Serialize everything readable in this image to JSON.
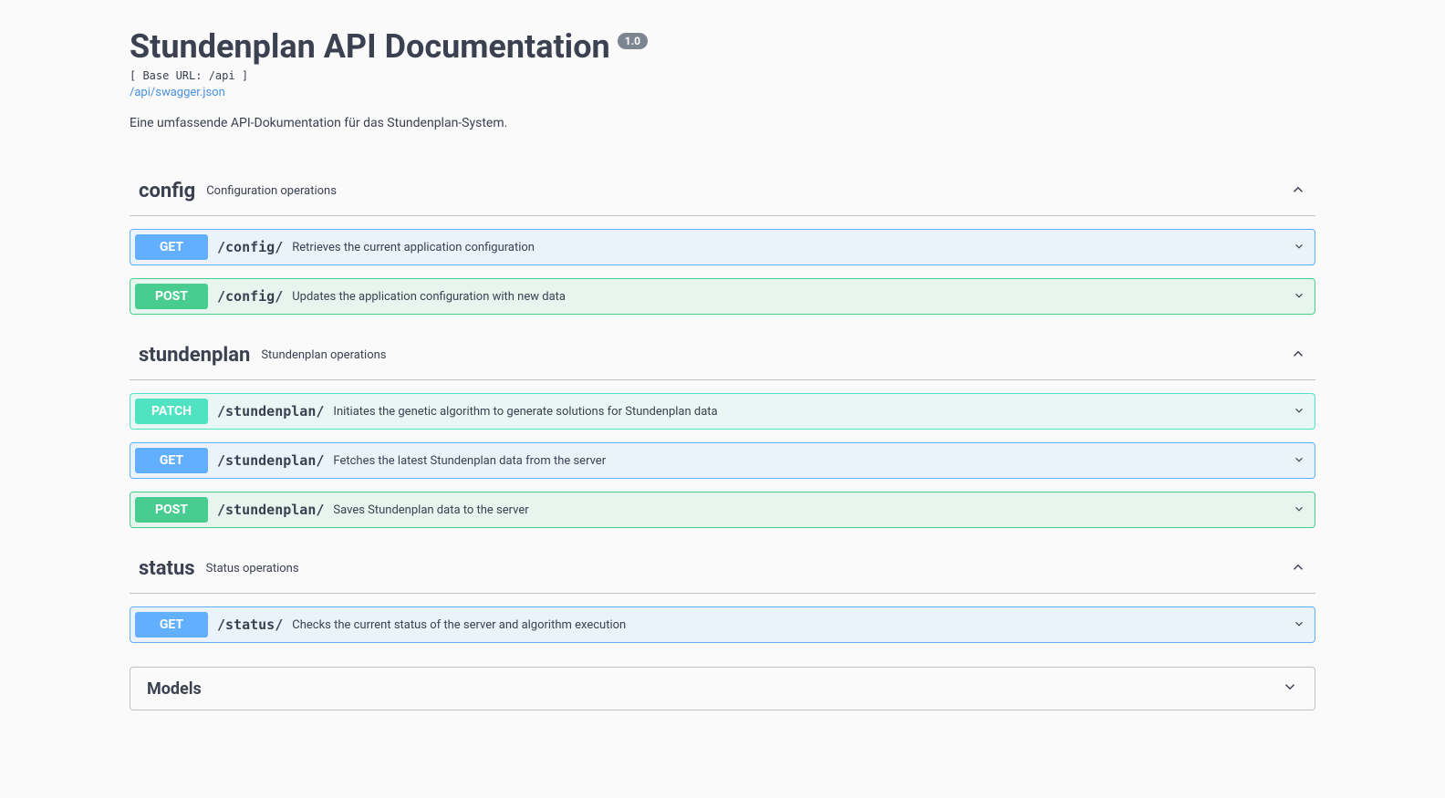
{
  "header": {
    "title": "Stundenplan API Documentation",
    "version": "1.0",
    "base_url_label": "[ Base URL: /api ]",
    "swagger_link": "/api/swagger.json",
    "description": "Eine umfassende API-Dokumentation für das Stundenplan-System."
  },
  "tags": [
    {
      "name": "config",
      "description": "Configuration operations",
      "operations": [
        {
          "method": "GET",
          "path": "/config/",
          "summary": "Retrieves the current application configuration"
        },
        {
          "method": "POST",
          "path": "/config/",
          "summary": "Updates the application configuration with new data"
        }
      ]
    },
    {
      "name": "stundenplan",
      "description": "Stundenplan operations",
      "operations": [
        {
          "method": "PATCH",
          "path": "/stundenplan/",
          "summary": "Initiates the genetic algorithm to generate solutions for Stundenplan data"
        },
        {
          "method": "GET",
          "path": "/stundenplan/",
          "summary": "Fetches the latest Stundenplan data from the server"
        },
        {
          "method": "POST",
          "path": "/stundenplan/",
          "summary": "Saves Stundenplan data to the server"
        }
      ]
    },
    {
      "name": "status",
      "description": "Status operations",
      "operations": [
        {
          "method": "GET",
          "path": "/status/",
          "summary": "Checks the current status of the server and algorithm execution"
        }
      ]
    }
  ],
  "models_label": "Models"
}
